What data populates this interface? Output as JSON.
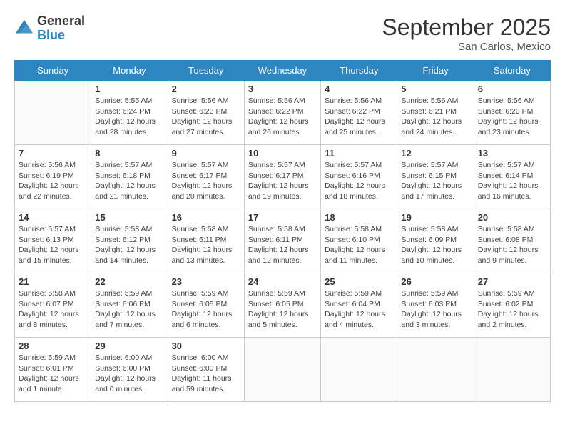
{
  "header": {
    "logo_general": "General",
    "logo_blue": "Blue",
    "month_title": "September 2025",
    "location": "San Carlos, Mexico"
  },
  "weekdays": [
    "Sunday",
    "Monday",
    "Tuesday",
    "Wednesday",
    "Thursday",
    "Friday",
    "Saturday"
  ],
  "weeks": [
    [
      {
        "day": "",
        "info": "",
        "empty": true
      },
      {
        "day": "1",
        "info": "Sunrise: 5:55 AM\nSunset: 6:24 PM\nDaylight: 12 hours\nand 28 minutes."
      },
      {
        "day": "2",
        "info": "Sunrise: 5:56 AM\nSunset: 6:23 PM\nDaylight: 12 hours\nand 27 minutes."
      },
      {
        "day": "3",
        "info": "Sunrise: 5:56 AM\nSunset: 6:22 PM\nDaylight: 12 hours\nand 26 minutes."
      },
      {
        "day": "4",
        "info": "Sunrise: 5:56 AM\nSunset: 6:22 PM\nDaylight: 12 hours\nand 25 minutes."
      },
      {
        "day": "5",
        "info": "Sunrise: 5:56 AM\nSunset: 6:21 PM\nDaylight: 12 hours\nand 24 minutes."
      },
      {
        "day": "6",
        "info": "Sunrise: 5:56 AM\nSunset: 6:20 PM\nDaylight: 12 hours\nand 23 minutes."
      }
    ],
    [
      {
        "day": "7",
        "info": "Sunrise: 5:56 AM\nSunset: 6:19 PM\nDaylight: 12 hours\nand 22 minutes."
      },
      {
        "day": "8",
        "info": "Sunrise: 5:57 AM\nSunset: 6:18 PM\nDaylight: 12 hours\nand 21 minutes."
      },
      {
        "day": "9",
        "info": "Sunrise: 5:57 AM\nSunset: 6:17 PM\nDaylight: 12 hours\nand 20 minutes."
      },
      {
        "day": "10",
        "info": "Sunrise: 5:57 AM\nSunset: 6:17 PM\nDaylight: 12 hours\nand 19 minutes."
      },
      {
        "day": "11",
        "info": "Sunrise: 5:57 AM\nSunset: 6:16 PM\nDaylight: 12 hours\nand 18 minutes."
      },
      {
        "day": "12",
        "info": "Sunrise: 5:57 AM\nSunset: 6:15 PM\nDaylight: 12 hours\nand 17 minutes."
      },
      {
        "day": "13",
        "info": "Sunrise: 5:57 AM\nSunset: 6:14 PM\nDaylight: 12 hours\nand 16 minutes."
      }
    ],
    [
      {
        "day": "14",
        "info": "Sunrise: 5:57 AM\nSunset: 6:13 PM\nDaylight: 12 hours\nand 15 minutes."
      },
      {
        "day": "15",
        "info": "Sunrise: 5:58 AM\nSunset: 6:12 PM\nDaylight: 12 hours\nand 14 minutes."
      },
      {
        "day": "16",
        "info": "Sunrise: 5:58 AM\nSunset: 6:11 PM\nDaylight: 12 hours\nand 13 minutes."
      },
      {
        "day": "17",
        "info": "Sunrise: 5:58 AM\nSunset: 6:11 PM\nDaylight: 12 hours\nand 12 minutes."
      },
      {
        "day": "18",
        "info": "Sunrise: 5:58 AM\nSunset: 6:10 PM\nDaylight: 12 hours\nand 11 minutes."
      },
      {
        "day": "19",
        "info": "Sunrise: 5:58 AM\nSunset: 6:09 PM\nDaylight: 12 hours\nand 10 minutes."
      },
      {
        "day": "20",
        "info": "Sunrise: 5:58 AM\nSunset: 6:08 PM\nDaylight: 12 hours\nand 9 minutes."
      }
    ],
    [
      {
        "day": "21",
        "info": "Sunrise: 5:58 AM\nSunset: 6:07 PM\nDaylight: 12 hours\nand 8 minutes."
      },
      {
        "day": "22",
        "info": "Sunrise: 5:59 AM\nSunset: 6:06 PM\nDaylight: 12 hours\nand 7 minutes."
      },
      {
        "day": "23",
        "info": "Sunrise: 5:59 AM\nSunset: 6:05 PM\nDaylight: 12 hours\nand 6 minutes."
      },
      {
        "day": "24",
        "info": "Sunrise: 5:59 AM\nSunset: 6:05 PM\nDaylight: 12 hours\nand 5 minutes."
      },
      {
        "day": "25",
        "info": "Sunrise: 5:59 AM\nSunset: 6:04 PM\nDaylight: 12 hours\nand 4 minutes."
      },
      {
        "day": "26",
        "info": "Sunrise: 5:59 AM\nSunset: 6:03 PM\nDaylight: 12 hours\nand 3 minutes."
      },
      {
        "day": "27",
        "info": "Sunrise: 5:59 AM\nSunset: 6:02 PM\nDaylight: 12 hours\nand 2 minutes."
      }
    ],
    [
      {
        "day": "28",
        "info": "Sunrise: 5:59 AM\nSunset: 6:01 PM\nDaylight: 12 hours\nand 1 minute."
      },
      {
        "day": "29",
        "info": "Sunrise: 6:00 AM\nSunset: 6:00 PM\nDaylight: 12 hours\nand 0 minutes."
      },
      {
        "day": "30",
        "info": "Sunrise: 6:00 AM\nSunset: 6:00 PM\nDaylight: 11 hours\nand 59 minutes."
      },
      {
        "day": "",
        "info": "",
        "empty": true
      },
      {
        "day": "",
        "info": "",
        "empty": true
      },
      {
        "day": "",
        "info": "",
        "empty": true
      },
      {
        "day": "",
        "info": "",
        "empty": true
      }
    ]
  ]
}
